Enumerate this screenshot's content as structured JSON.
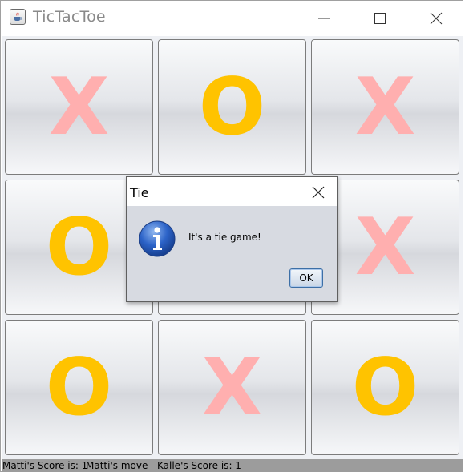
{
  "window": {
    "title": "TicTacToe",
    "icon": "java-cup-icon",
    "controls": [
      "minimize-icon",
      "maximize-icon",
      "close-icon"
    ]
  },
  "board": {
    "cells": [
      "X",
      "O",
      "X",
      "O",
      "",
      "X",
      "O",
      "X",
      "O"
    ],
    "colors": {
      "X": "#ffafaf",
      "O": "#ffc300"
    }
  },
  "status": {
    "player1_score": "Matti's Score is: 1",
    "turn": "Matti's move",
    "player2_score": "Kalle's Score is: 1"
  },
  "dialog": {
    "title": "Tie",
    "message": "It's a tie game!",
    "icon": "info-icon",
    "ok_label": "OK"
  }
}
